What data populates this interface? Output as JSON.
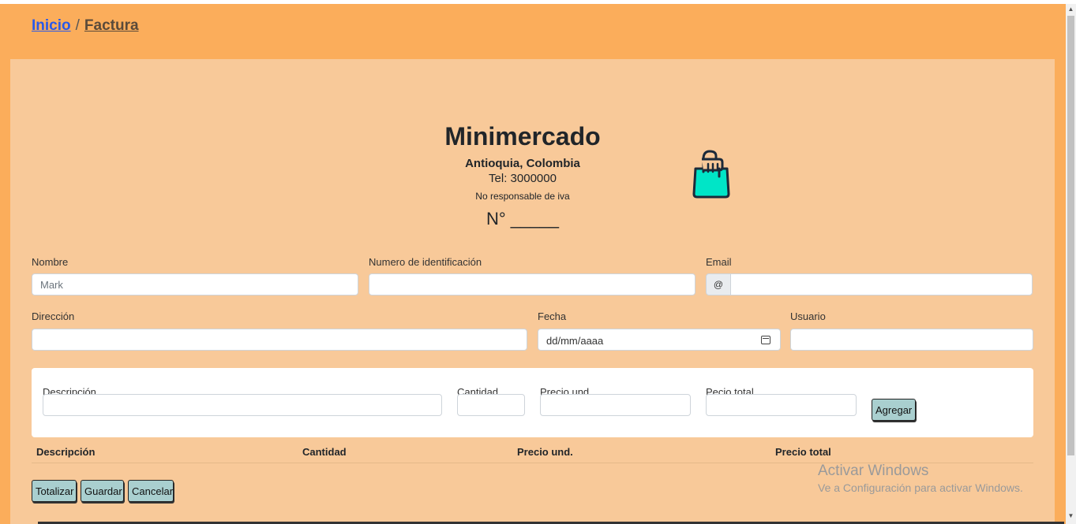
{
  "breadcrumb": {
    "home": "Inicio",
    "separator": "/",
    "current": "Factura"
  },
  "header": {
    "store_name": "Minimercado",
    "location": "Antioquia, Colombia",
    "phone": "Tel: 3000000",
    "tax_note": "No responsable de iva",
    "invoice_number": "N° _____",
    "logo_icon": "shopping-bag-icon"
  },
  "form": {
    "nombre": {
      "label": "Nombre",
      "placeholder": "Mark",
      "value": ""
    },
    "identificacion": {
      "label": "Numero de identificación",
      "value": ""
    },
    "email": {
      "label": "Email",
      "addon": "@",
      "value": ""
    },
    "direccion": {
      "label": "Dirección",
      "value": ""
    },
    "fecha": {
      "label": "Fecha",
      "placeholder": "dd/mm/aaaa",
      "icon": "calendar-icon"
    },
    "usuario": {
      "label": "Usuario",
      "value": ""
    }
  },
  "item_entry": {
    "descripcion_label": "Descripción",
    "cantidad_label": "Cantidad",
    "precio_und_label": "Precio und.",
    "precio_total_label": "Pecio total",
    "add_button": "Agregar"
  },
  "table": {
    "columns": [
      "Descripción",
      "Cantidad",
      "Precio und.",
      "Precio total"
    ],
    "rows": []
  },
  "actions": {
    "totalize": "Totalizar",
    "save": "Guardar",
    "cancel": "Cancelar"
  },
  "watermark": {
    "line1": "Activar Windows",
    "line2": "Ve a Configuración para activar Windows."
  },
  "colors": {
    "page_bg": "#fbad5b",
    "panel_bg": "#f8c999",
    "accent_button": "#a9cfcf",
    "bag_fill": "#00e5c7",
    "link": "#2a59e8"
  }
}
